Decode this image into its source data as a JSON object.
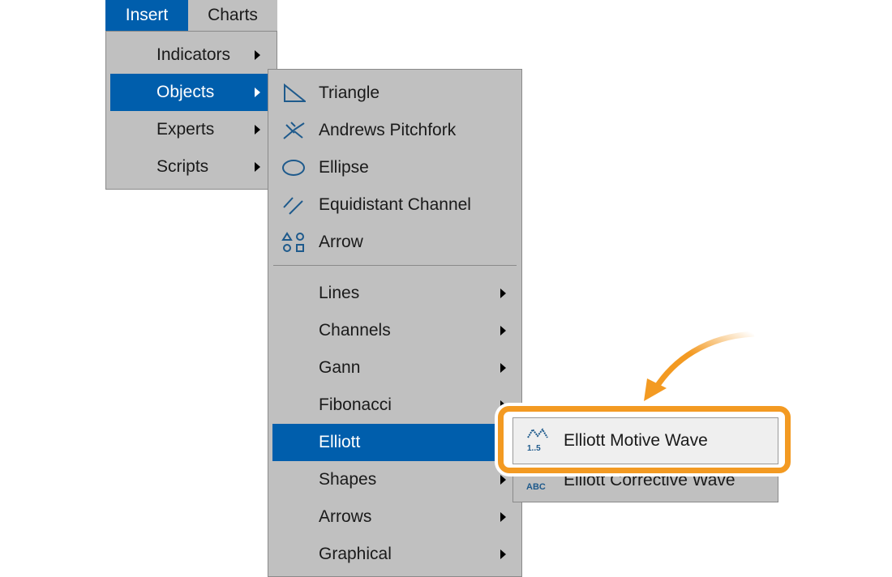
{
  "menubar": {
    "items": [
      {
        "label": "Insert",
        "active": true
      },
      {
        "label": "Charts",
        "active": false
      }
    ]
  },
  "insert_menu": {
    "items": [
      {
        "label": "Indicators"
      },
      {
        "label": "Objects",
        "selected": true
      },
      {
        "label": "Experts"
      },
      {
        "label": "Scripts"
      }
    ]
  },
  "objects_menu": {
    "tools": [
      {
        "label": "Triangle",
        "icon": "triangle-icon"
      },
      {
        "label": "Andrews Pitchfork",
        "icon": "pitchfork-icon"
      },
      {
        "label": "Ellipse",
        "icon": "ellipse-icon"
      },
      {
        "label": "Equidistant Channel",
        "icon": "channel-icon"
      },
      {
        "label": "Arrow",
        "icon": "shapes-icon"
      }
    ],
    "submenus": [
      {
        "label": "Lines"
      },
      {
        "label": "Channels"
      },
      {
        "label": "Gann"
      },
      {
        "label": "Fibonacci"
      },
      {
        "label": "Elliott",
        "selected": true
      },
      {
        "label": "Shapes"
      },
      {
        "label": "Arrows"
      },
      {
        "label": "Graphical"
      }
    ]
  },
  "elliott_menu": {
    "items": [
      {
        "label": "Elliott Motive Wave",
        "icon_text": "1..5",
        "highlighted": true
      },
      {
        "label": "Elliott Corrective Wave",
        "icon_text": "ABC"
      }
    ]
  },
  "colors": {
    "accent": "#005eac",
    "highlight": "#f39a22",
    "menu_bg": "#c0c0c0",
    "icon": "#1e5a8c"
  }
}
